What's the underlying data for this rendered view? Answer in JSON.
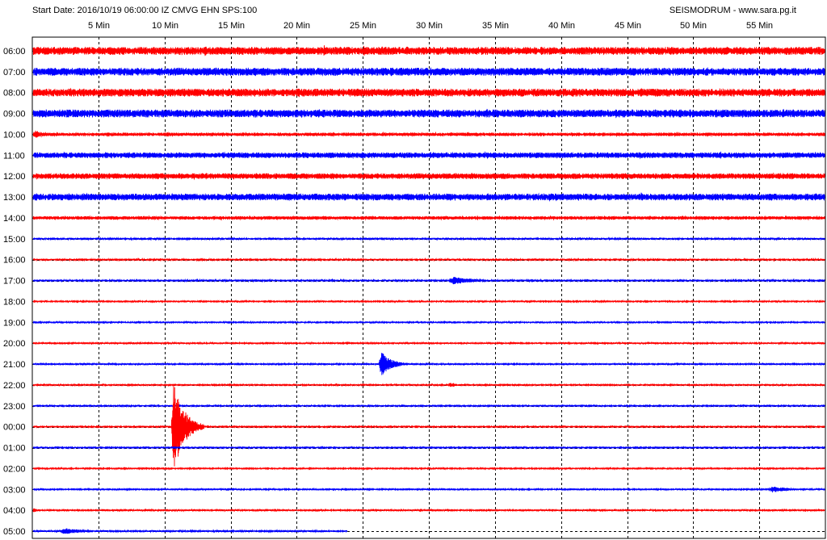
{
  "header": {
    "start_info": "Start Date: 2016/10/19 06:00:00 IZ CMVG EHN SPS:100",
    "credit": "SEISMODRUM - www.sara.pg.it"
  },
  "chart_data": {
    "type": "line",
    "title": "",
    "x_unit": "minutes",
    "xlim": [
      0,
      60
    ],
    "x_ticks": [
      {
        "value": 5,
        "label": "5 Min"
      },
      {
        "value": 10,
        "label": "10 Min"
      },
      {
        "value": 15,
        "label": "15 Min"
      },
      {
        "value": 20,
        "label": "20 Min"
      },
      {
        "value": 25,
        "label": "25 Min"
      },
      {
        "value": 30,
        "label": "30 Min"
      },
      {
        "value": 35,
        "label": "35 Min"
      },
      {
        "value": 40,
        "label": "40 Min"
      },
      {
        "value": 45,
        "label": "45 Min"
      },
      {
        "value": 50,
        "label": "50 Min"
      },
      {
        "value": 55,
        "label": "55 Min"
      }
    ],
    "grid": true,
    "colors": {
      "odd_rows": "#ff0000",
      "even_rows": "#0000ff",
      "grid": "#000000"
    },
    "rows": [
      {
        "label": "06:00",
        "color": "#ff0000",
        "noise": 3.5,
        "end_min": 60
      },
      {
        "label": "07:00",
        "color": "#0000ff",
        "noise": 3.5,
        "end_min": 60
      },
      {
        "label": "08:00",
        "color": "#ff0000",
        "noise": 3.5,
        "end_min": 60
      },
      {
        "label": "09:00",
        "color": "#0000ff",
        "noise": 3.5,
        "end_min": 60
      },
      {
        "label": "10:00",
        "color": "#ff0000",
        "noise": 1.5,
        "end_min": 60
      },
      {
        "label": "11:00",
        "color": "#0000ff",
        "noise": 2.5,
        "end_min": 60
      },
      {
        "label": "12:00",
        "color": "#ff0000",
        "noise": 2.5,
        "end_min": 60
      },
      {
        "label": "13:00",
        "color": "#0000ff",
        "noise": 3,
        "end_min": 60
      },
      {
        "label": "14:00",
        "color": "#ff0000",
        "noise": 1.5,
        "end_min": 60
      },
      {
        "label": "15:00",
        "color": "#0000ff",
        "noise": 0.8,
        "end_min": 60
      },
      {
        "label": "16:00",
        "color": "#ff0000",
        "noise": 0.8,
        "end_min": 60
      },
      {
        "label": "17:00",
        "color": "#0000ff",
        "noise": 0.8,
        "end_min": 60
      },
      {
        "label": "18:00",
        "color": "#ff0000",
        "noise": 0.6,
        "end_min": 60
      },
      {
        "label": "19:00",
        "color": "#0000ff",
        "noise": 0.6,
        "end_min": 60
      },
      {
        "label": "20:00",
        "color": "#ff0000",
        "noise": 0.6,
        "end_min": 60
      },
      {
        "label": "21:00",
        "color": "#0000ff",
        "noise": 0.6,
        "end_min": 60
      },
      {
        "label": "22:00",
        "color": "#ff0000",
        "noise": 0.5,
        "end_min": 60
      },
      {
        "label": "23:00",
        "color": "#0000ff",
        "noise": 0.5,
        "end_min": 60
      },
      {
        "label": "00:00",
        "color": "#ff0000",
        "noise": 0.5,
        "end_min": 60
      },
      {
        "label": "01:00",
        "color": "#0000ff",
        "noise": 0.5,
        "end_min": 60
      },
      {
        "label": "02:00",
        "color": "#ff0000",
        "noise": 0.5,
        "end_min": 60
      },
      {
        "label": "03:00",
        "color": "#0000ff",
        "noise": 0.5,
        "end_min": 60
      },
      {
        "label": "04:00",
        "color": "#ff0000",
        "noise": 0.6,
        "end_min": 60
      },
      {
        "label": "05:00",
        "color": "#0000ff",
        "noise": 0.8,
        "end_min": 23.8
      }
    ],
    "events": [
      {
        "row": 0,
        "start_min": 1.0,
        "dur_min": 0.6,
        "amp": 7
      },
      {
        "row": 0,
        "start_min": 13.0,
        "dur_min": 0.8,
        "amp": 7
      },
      {
        "row": 0,
        "start_min": 14.5,
        "dur_min": 0.6,
        "amp": 7
      },
      {
        "row": 0,
        "start_min": 22.0,
        "dur_min": 0.8,
        "amp": 8
      },
      {
        "row": 0,
        "start_min": 25.0,
        "dur_min": 0.8,
        "amp": 7
      },
      {
        "row": 1,
        "start_min": 27.0,
        "dur_min": 1.5,
        "amp": 6
      },
      {
        "row": 1,
        "start_min": 36.0,
        "dur_min": 1.2,
        "amp": 6
      },
      {
        "row": 3,
        "start_min": 42.0,
        "dur_min": 1.0,
        "amp": 6
      },
      {
        "row": 4,
        "start_min": 0.0,
        "dur_min": 2.5,
        "amp": 5
      },
      {
        "row": 7,
        "start_min": 46.0,
        "dur_min": 0.8,
        "amp": 6
      },
      {
        "row": 16,
        "start_min": 31.4,
        "dur_min": 2.2,
        "amp": 3
      },
      {
        "row": 11,
        "start_min": 31.4,
        "dur_min": 5.5,
        "amp": 5
      },
      {
        "row": 15,
        "start_min": 26.2,
        "dur_min": 2.5,
        "amp": 16
      },
      {
        "row": 18,
        "start_min": 10.5,
        "dur_min": 2.5,
        "amp": 58
      },
      {
        "row": 21,
        "start_min": 55.6,
        "dur_min": 4.4,
        "amp": 4
      },
      {
        "row": 22,
        "start_min": 0.0,
        "dur_min": 1.0,
        "amp": 3
      },
      {
        "row": 23,
        "start_min": 2.0,
        "dur_min": 5.0,
        "amp": 4
      }
    ]
  }
}
